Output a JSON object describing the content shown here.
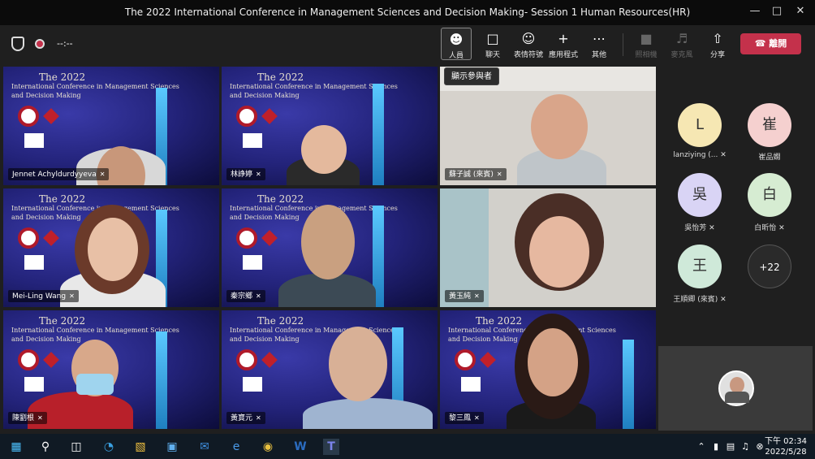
{
  "window": {
    "title": "The 2022 International Conference in Management Sciences and Decision Making- Session 1 Human Resources(HR)"
  },
  "toolbar": {
    "timer": "--:--",
    "people": "人員",
    "chat": "聊天",
    "reactions": "表情符號",
    "apps": "應用程式",
    "more": "其他",
    "camera": "照相機",
    "mic": "麥克風",
    "share": "分享",
    "leave": "離開"
  },
  "tooltip": "顯示參與者",
  "conference_banner": {
    "year": "The 2022",
    "line1": "International Conference in Management Sciences",
    "line2": "and Decision Making"
  },
  "participants": [
    {
      "name": "Jennet Achyldurdyyeva"
    },
    {
      "name": "林諍婷"
    },
    {
      "name": "蘇子誠 (來賓)"
    },
    {
      "name": "Mei-Ling Wang"
    },
    {
      "name": "秦宗鄉"
    },
    {
      "name": "黃玉純"
    },
    {
      "name": "陳劉根"
    },
    {
      "name": "黃寶元"
    },
    {
      "name": "黎三鳳"
    }
  ],
  "sidebar": [
    {
      "initial": "L",
      "name": "lanziying (...",
      "color": "#f6e7b3"
    },
    {
      "initial": "崔",
      "name": "崔品嫺",
      "color": "#f5d0cf"
    },
    {
      "initial": "吳",
      "name": "吳怡芳",
      "color": "#d9d4f5"
    },
    {
      "initial": "白",
      "name": "白昕怡",
      "color": "#d6ecd2"
    },
    {
      "initial": "王",
      "name": "王順卿 (來賓)",
      "color": "#cfe9d9"
    },
    {
      "initial": "+22",
      "name": "",
      "color": "#2a2a2a"
    }
  ],
  "clock": {
    "time": "下午 02:34",
    "date": "2022/5/28"
  }
}
